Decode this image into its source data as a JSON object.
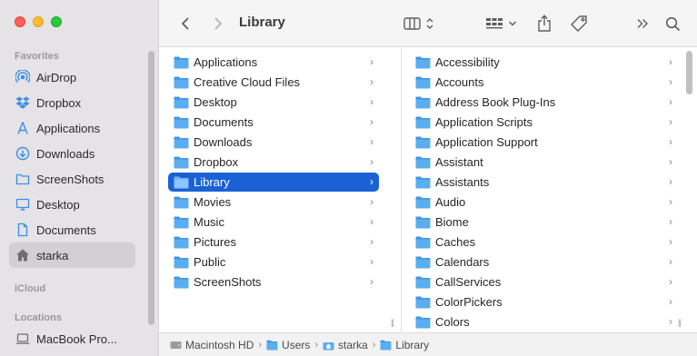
{
  "window": {
    "title": "Library"
  },
  "sidebar": {
    "sections": [
      {
        "label": "Favorites"
      },
      {
        "label": "iCloud"
      },
      {
        "label": "Locations"
      }
    ],
    "favorites": [
      {
        "label": "AirDrop",
        "icon": "airdrop-icon"
      },
      {
        "label": "Dropbox",
        "icon": "dropbox-icon"
      },
      {
        "label": "Applications",
        "icon": "applications-icon"
      },
      {
        "label": "Downloads",
        "icon": "downloads-icon"
      },
      {
        "label": "ScreenShots",
        "icon": "folder-icon"
      },
      {
        "label": "Desktop",
        "icon": "desktop-icon"
      },
      {
        "label": "Documents",
        "icon": "document-icon"
      },
      {
        "label": "starka",
        "icon": "home-icon",
        "selected": true
      }
    ],
    "locations": [
      {
        "label": "MacBook Pro...",
        "icon": "laptop-icon"
      }
    ]
  },
  "toolbar": {
    "back": "back",
    "forward": "forward",
    "title": "Library",
    "view": "column-view",
    "group": "group-by",
    "share": "share",
    "tag": "tag",
    "more": "more",
    "search": "search"
  },
  "column1": [
    {
      "label": "Applications"
    },
    {
      "label": "Creative Cloud Files"
    },
    {
      "label": "Desktop"
    },
    {
      "label": "Documents"
    },
    {
      "label": "Downloads"
    },
    {
      "label": "Dropbox"
    },
    {
      "label": "Library",
      "selected": true
    },
    {
      "label": "Movies"
    },
    {
      "label": "Music"
    },
    {
      "label": "Pictures"
    },
    {
      "label": "Public"
    },
    {
      "label": "ScreenShots"
    }
  ],
  "column2": [
    {
      "label": "Accessibility"
    },
    {
      "label": "Accounts"
    },
    {
      "label": "Address Book Plug-Ins"
    },
    {
      "label": "Application Scripts"
    },
    {
      "label": "Application Support"
    },
    {
      "label": "Assistant"
    },
    {
      "label": "Assistants"
    },
    {
      "label": "Audio"
    },
    {
      "label": "Biome"
    },
    {
      "label": "Caches"
    },
    {
      "label": "Calendars"
    },
    {
      "label": "CallServices"
    },
    {
      "label": "ColorPickers"
    },
    {
      "label": "Colors"
    }
  ],
  "pathbar": [
    {
      "label": "Macintosh HD",
      "icon": "disk-icon"
    },
    {
      "label": "Users",
      "icon": "folder-icon"
    },
    {
      "label": "starka",
      "icon": "home-icon"
    },
    {
      "label": "Library",
      "icon": "folder-icon"
    }
  ],
  "colors": {
    "accent": "#1a62d4",
    "folder": "#5aaef0",
    "sidebar_icon": "#3b8ee8"
  }
}
